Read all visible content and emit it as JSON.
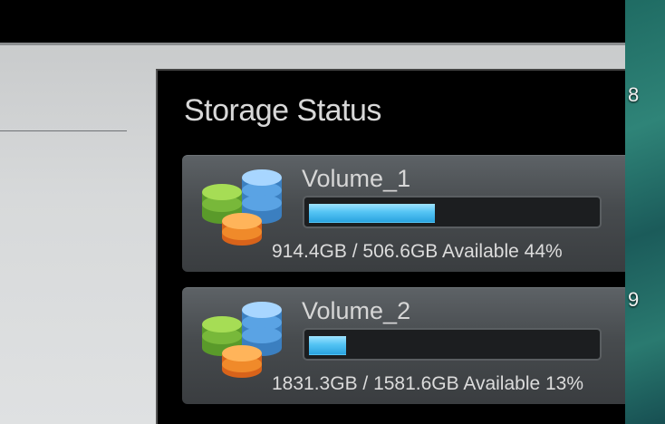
{
  "panel": {
    "title": "Storage Status"
  },
  "desktop": {
    "numbers": [
      "8",
      "9"
    ]
  },
  "volumes": [
    {
      "name": "Volume_1",
      "usage_text": "914.4GB / 506.6GB Available  44%",
      "used_percent": 44
    },
    {
      "name": "Volume_2",
      "usage_text": "1831.3GB / 1581.6GB Available  13%",
      "used_percent": 13
    }
  ],
  "colors": {
    "bar_fill": "#55c4f4",
    "panel_bg": "#000000",
    "card_bg": "#474b4e"
  },
  "icons": {
    "volume": "database-stack-icon"
  }
}
